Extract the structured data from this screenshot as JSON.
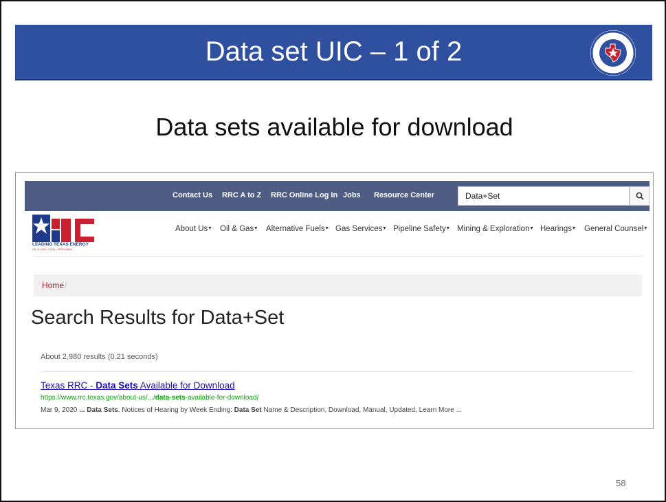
{
  "slide": {
    "title": "Data set UIC – 1 of 2",
    "subtitle": "Data sets available for download",
    "page_number": "58"
  },
  "screenshot": {
    "top_nav": {
      "links": [
        "Contact Us",
        "RRC A to Z",
        "RRC Online Log In",
        "Jobs",
        "Resource Center"
      ],
      "search_value": "Data+Set"
    },
    "logo": {
      "letters": "RRC",
      "tagline": "LEADING TEXAS ENERGY",
      "subline": "OIL & GAS • COAL • PIPELINES"
    },
    "main_nav": {
      "items": [
        {
          "label": "About Us"
        },
        {
          "label": "Oil & Gas"
        },
        {
          "label": "Alternative Fuels"
        },
        {
          "label": "Gas Services"
        },
        {
          "label": "Pipeline Safety"
        },
        {
          "label": "Mining & Exploration"
        },
        {
          "label": "Hearings"
        },
        {
          "label": "General Counsel"
        }
      ]
    },
    "breadcrumb": {
      "home": "Home",
      "separator": "/"
    },
    "results_title": "Search Results for Data+Set",
    "results_count": "About 2,980 results (0.21 seconds)",
    "result": {
      "title_prefix": "Texas RRC - ",
      "title_bold": "Data Sets",
      "title_suffix": " Available for Download",
      "url_prefix": "https://www.rrc.texas.gov/about-us/.../",
      "url_bold": "data-sets",
      "url_suffix": "-available-for-download/",
      "snippet_date": "Mar 9, 2020 ",
      "snippet_ellipsis": "... ",
      "snippet_bold1": "Data Sets",
      "snippet_mid": ". Notices of Hearing by Week Ending: ",
      "snippet_bold2": "Data Set",
      "snippet_end": " Name & Description, Download, Manual, Updated, Learn More ..."
    }
  },
  "colors": {
    "title_bar": "#2f4f9f",
    "top_nav": "#4f5d85",
    "link_blue": "#1a0dab",
    "url_green": "#12a112",
    "breadcrumb_red": "#9a1f28",
    "rrc_red": "#c8202f",
    "rrc_blue": "#1f3a8a"
  },
  "icons": {
    "search_button": "search-icon",
    "seal": "railroad-commission-seal-icon",
    "caret": "caret-down-icon"
  }
}
